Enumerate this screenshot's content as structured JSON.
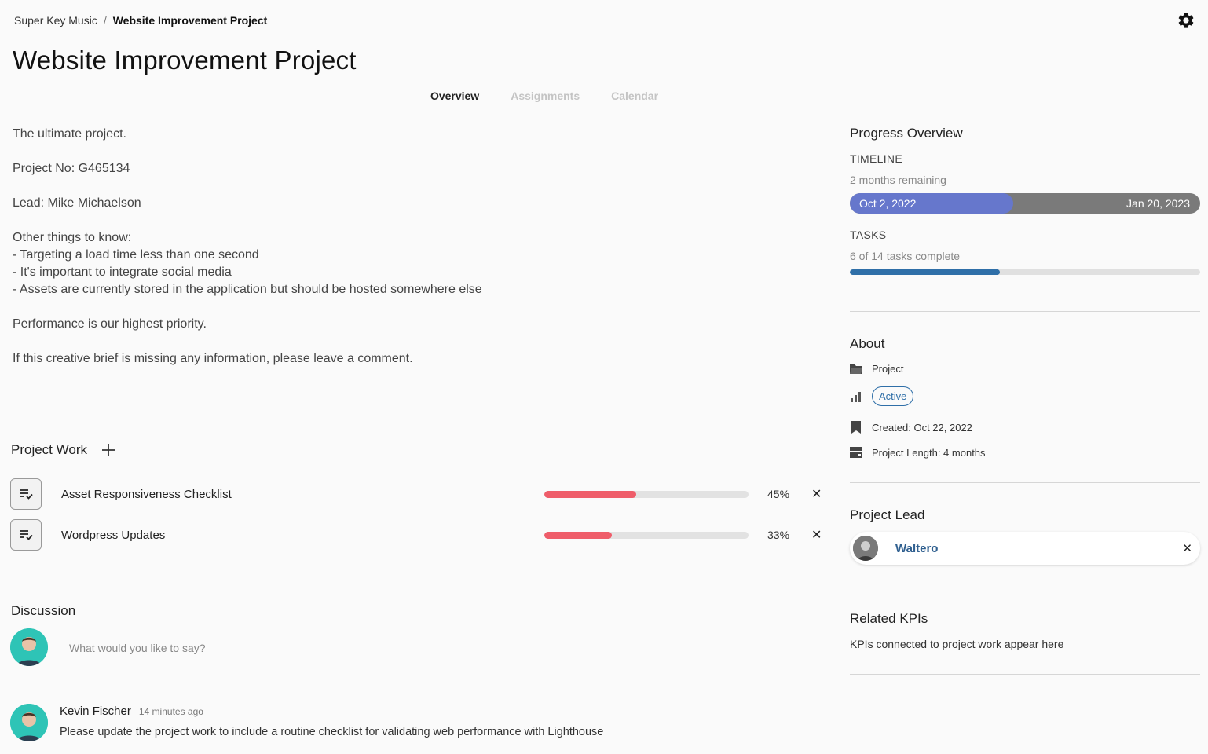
{
  "breadcrumb": {
    "parent": "Super Key Music",
    "separator": "/",
    "current": "Website Improvement Project"
  },
  "page_title": "Website Improvement Project",
  "tabs": [
    {
      "label": "Overview",
      "active": true
    },
    {
      "label": "Assignments",
      "active": false
    },
    {
      "label": "Calendar",
      "active": false
    }
  ],
  "description": {
    "intro": "The ultimate project.",
    "project_no": "Project No: G465134",
    "lead": "Lead: Mike Michaelson",
    "other_heading": "Other things to know:",
    "other_items": [
      "- Targeting a load time less than one second",
      "- It's important to integrate social media",
      "- Assets are currently stored in the application but should be hosted somewhere else"
    ],
    "priority": "Performance is our highest priority.",
    "closing": "If this creative brief is missing any information, please leave a comment."
  },
  "project_work": {
    "title": "Project Work",
    "add_label": "+",
    "items": [
      {
        "name": "Asset Responsiveness Checklist",
        "progress": 0.45,
        "percent_label": "45%"
      },
      {
        "name": "Wordpress Updates",
        "progress": 0.33,
        "percent_label": "33%"
      }
    ],
    "remove_label": "✕"
  },
  "discussion": {
    "title": "Discussion",
    "input_placeholder": "What would you like to say?",
    "comments": [
      {
        "author": "Kevin Fischer",
        "time": "14 minutes ago",
        "text": "Please update the project work to include a routine checklist for validating web performance with Lighthouse"
      }
    ]
  },
  "progress_overview": {
    "title": "Progress Overview",
    "timeline_label": "TIMELINE",
    "timeline_remaining": "2 months remaining",
    "start_date": "Oct 2, 2022",
    "end_date": "Jan 20, 2023",
    "timeline_progress": 0.467,
    "tasks_label": "TASKS",
    "tasks_summary": "6 of 14 tasks complete",
    "tasks_progress": 0.4286
  },
  "about": {
    "title": "About",
    "type": "Project",
    "status": "Active",
    "created": "Created: Oct 22, 2022",
    "length": "Project Length: 4 months"
  },
  "project_lead": {
    "title": "Project Lead",
    "name": "Waltero",
    "remove_label": "✕"
  },
  "related_kpis": {
    "title": "Related KPIs",
    "empty_text": "KPIs connected to project work appear here"
  },
  "colors": {
    "accent_blue": "#2f6fa8",
    "timeline_purple": "#6677cc",
    "work_red": "#ef5d6a",
    "avatar_teal": "#2ec4b6"
  },
  "icons": [
    "gear-icon",
    "checklist-icon",
    "close-icon",
    "plus-icon",
    "folder-icon",
    "status-bars-icon",
    "bookmark-icon",
    "calendar-length-icon"
  ]
}
